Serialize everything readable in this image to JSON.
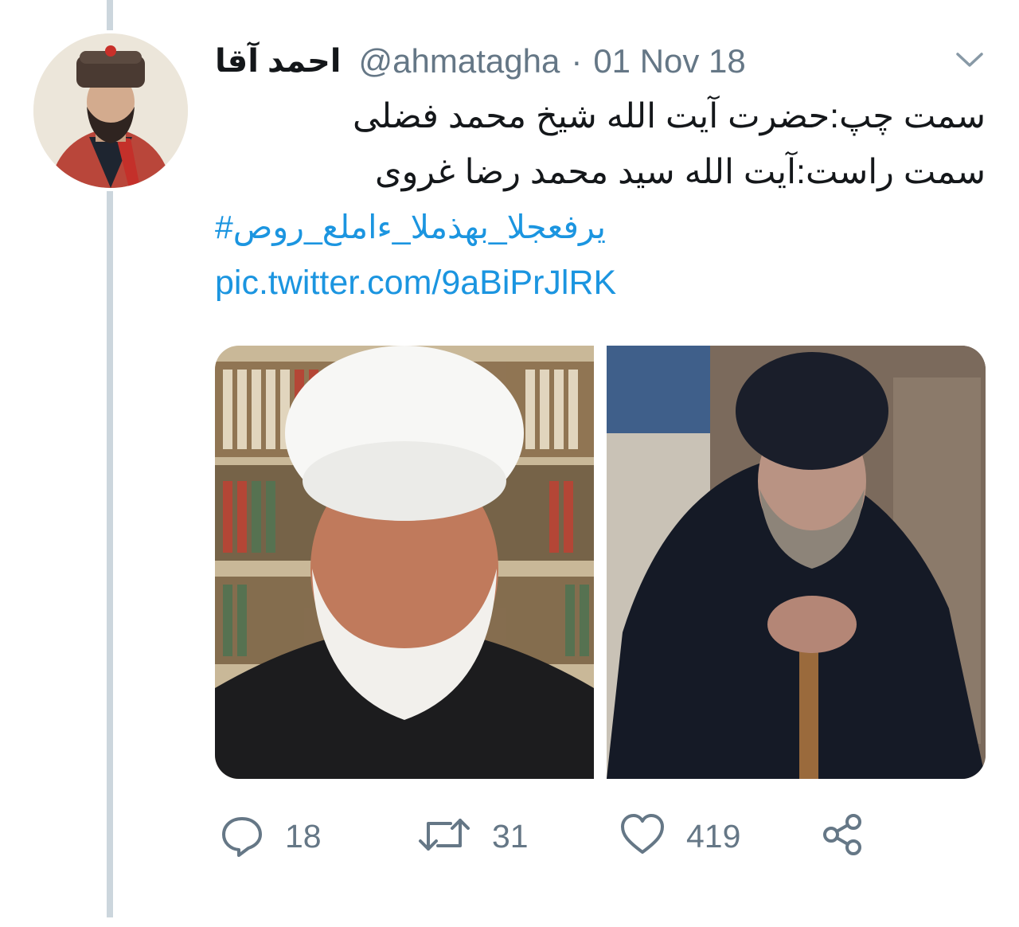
{
  "tweet": {
    "display_name": "احمد آقا",
    "handle": "@ahmatagha",
    "separator": "·",
    "date": "01 Nov 18",
    "text_lines": [
      "سمت چپ:حضرت آیت الله شیخ محمد فضلی",
      "سمت راست:آیت الله سید محمد رضا غروی"
    ],
    "hashtag": "#صور_علماء_المذهب_الجعفری",
    "link": "pic.twitter.com/9aBiPrJlRK"
  },
  "actions": {
    "reply_count": "18",
    "retweet_count": "31",
    "like_count": "419"
  },
  "icons": {
    "caret": "chevron-down-icon",
    "reply": "speech-bubble-icon",
    "retweet": "retweet-arrows-icon",
    "like": "heart-icon",
    "share": "share-nodes-icon"
  },
  "colors": {
    "link": "#1b95e0",
    "muted": "#657786",
    "thread_line": "#ccd6dd"
  }
}
